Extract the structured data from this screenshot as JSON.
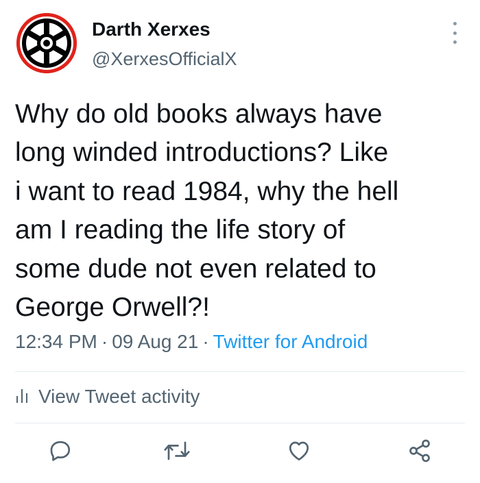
{
  "user": {
    "display_name": "Darth Xerxes",
    "handle": "@XerxesOfficialX",
    "avatar_icon": "imperial-emblem-icon",
    "avatar_ring_color": "#e0231b"
  },
  "tweet": {
    "lines": [
      "Why do old books always have",
      "long winded introductions? Like",
      "i want to read 1984, why the hell",
      "am I reading the life story of",
      "some dude not even related to",
      "George Orwell?!"
    ],
    "time": "12:34 PM",
    "date": "09 Aug 21",
    "source": "Twitter for Android"
  },
  "activity": {
    "label": "View Tweet activity",
    "icon": "analytics-bars-icon"
  },
  "actions": {
    "reply_icon": "reply-icon",
    "retweet_icon": "retweet-icon",
    "like_icon": "heart-icon",
    "share_icon": "share-icon"
  },
  "colors": {
    "text": "#0f1419",
    "secondary": "#536471",
    "link": "#1d9bf0"
  }
}
